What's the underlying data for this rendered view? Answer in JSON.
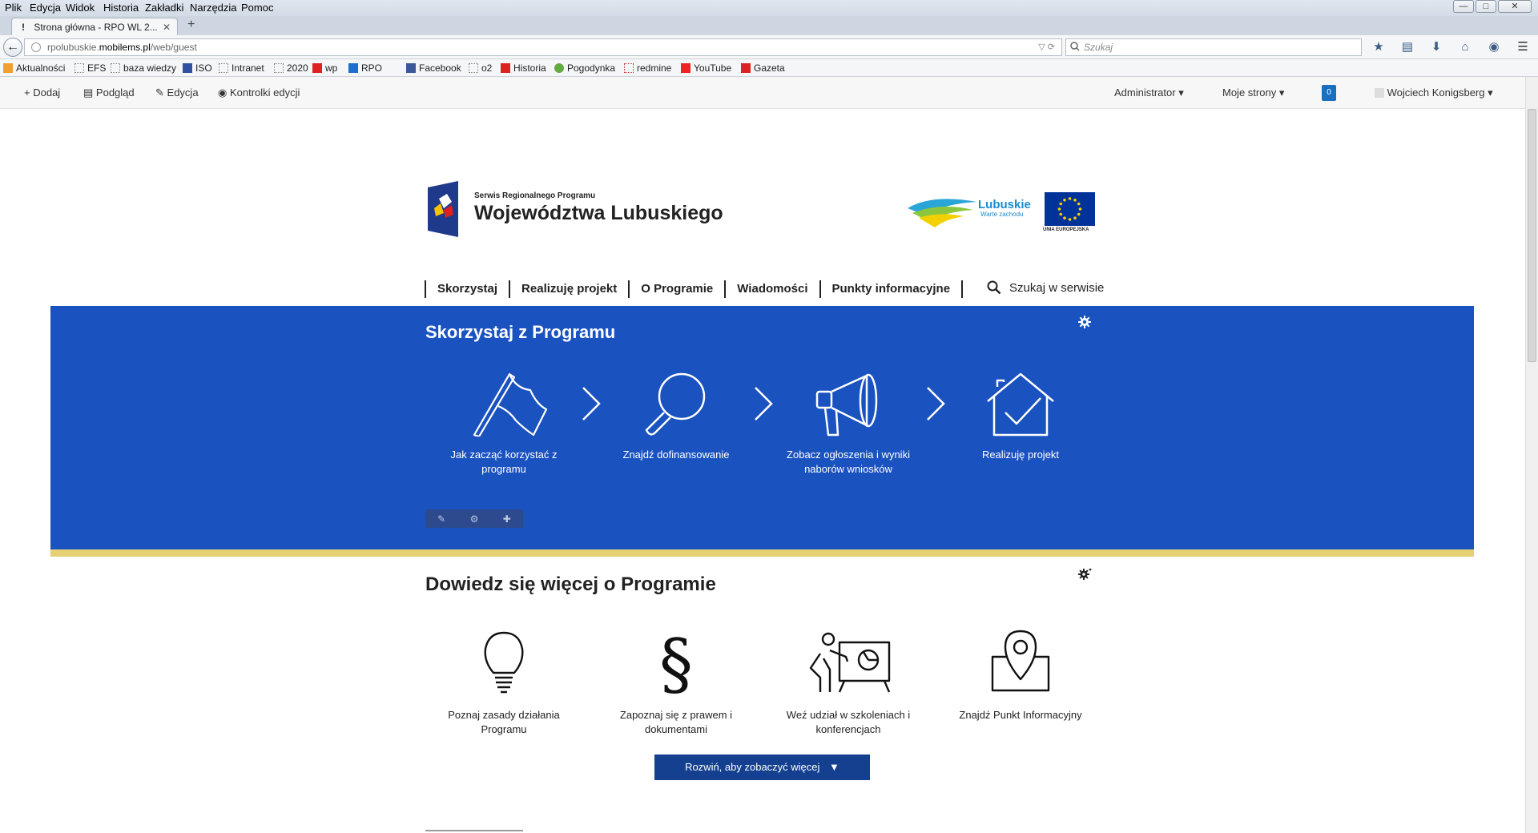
{
  "browser": {
    "menu": [
      "Plik",
      "Edycja",
      "Widok",
      "Historia",
      "Zakładki",
      "Narzędzia",
      "Pomoc"
    ],
    "tab_title": "Strona główna - RPO WL 2...",
    "tab_icon": "!",
    "url_prefix": "rpolubuskie.",
    "url_domain": "mobilems.pl",
    "url_path": "/web/guest",
    "search_placeholder": "Szukaj",
    "bookmarks": [
      "Aktualności",
      "EFS",
      "baza wiedzy",
      "ISO",
      "Intranet",
      "2020",
      "wp",
      "RPO",
      "Facebook",
      "o2",
      "Historia",
      "Pogodynka",
      "redmine",
      "YouTube",
      "Gazeta"
    ]
  },
  "toolbar": {
    "add": "Dodaj",
    "preview": "Podgląd",
    "edit": "Edycja",
    "edit_controls": "Kontrolki edycji",
    "admin": "Administrator",
    "my_pages": "Moje strony",
    "notif_count": "0",
    "user": "Wojciech Konigsberg"
  },
  "header": {
    "small": "Serwis Regionalnego Programu",
    "big": "Województwa Lubuskiego",
    "lubuskie": "Lubuskie",
    "lubuskie_sub": "Warte zachodu",
    "eu": "UNIA EUROPEJSKA"
  },
  "nav": {
    "items": [
      "Skorzystaj",
      "Realizuję projekt",
      "O Programie",
      "Wiadomości",
      "Punkty informacyjne"
    ],
    "search": "Szukaj w serwisie"
  },
  "blue_section": {
    "title": "Skorzystaj z Programu",
    "steps": [
      {
        "label_1": "Jak zacząć korzystać z",
        "label_2": "programu",
        "icon": "flag-icon"
      },
      {
        "label_1": "Znajdź dofinansowanie",
        "label_2": "",
        "icon": "magnifier-icon"
      },
      {
        "label_1": "Zobacz ogłoszenia i wyniki",
        "label_2": "naborów wniosków",
        "icon": "megaphone-icon"
      },
      {
        "label_1": "Realizuję projekt",
        "label_2": "",
        "icon": "house-check-icon"
      }
    ]
  },
  "more_section": {
    "title": "Dowiedz się więcej o Programie",
    "items": [
      {
        "label_1": "Poznaj zasady działania",
        "label_2": "Programu",
        "icon": "lightbulb-icon"
      },
      {
        "label_1": "Zapoznaj się z prawem i",
        "label_2": "dokumentami",
        "icon": "paragraph-icon"
      },
      {
        "label_1": "Weź udział w szkoleniach i",
        "label_2": "konferencjach",
        "icon": "presentation-icon"
      },
      {
        "label_1": "Znajdź Punkt Informacyjny",
        "label_2": "",
        "icon": "map-pin-icon"
      }
    ],
    "expand_button": "Rozwiń, aby zobaczyć więcej"
  },
  "colors": {
    "blue": "#1a52c0",
    "yellow": "#e6d175",
    "button": "#14408f"
  }
}
